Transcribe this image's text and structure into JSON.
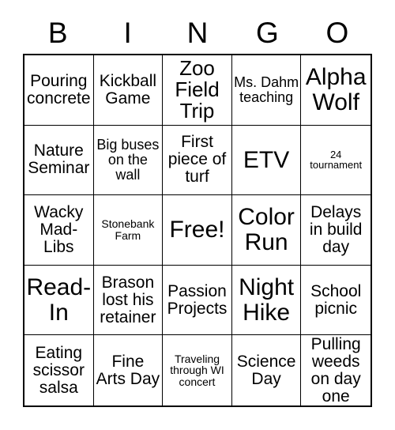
{
  "card": {
    "header_letters": [
      "B",
      "I",
      "N",
      "G",
      "O"
    ],
    "columns": 5,
    "rows": 5,
    "border_color": "#000000",
    "background_color": "#ffffff",
    "text_color": "#000000",
    "cells": [
      {
        "text": "Pouring concrete",
        "size": "md"
      },
      {
        "text": "Kickball Game",
        "size": "md"
      },
      {
        "text": "Zoo Field Trip",
        "size": "lg"
      },
      {
        "text": "Ms. Dahm teaching",
        "size": "sm"
      },
      {
        "text": "Alpha Wolf",
        "size": "xl"
      },
      {
        "text": "Nature Seminar",
        "size": "md"
      },
      {
        "text": "Big buses on the wall",
        "size": "sm"
      },
      {
        "text": "First piece of turf",
        "size": "md"
      },
      {
        "text": "ETV",
        "size": "xl"
      },
      {
        "text": "24 tournament",
        "size": "xxs"
      },
      {
        "text": "Wacky Mad-Libs",
        "size": "md"
      },
      {
        "text": "Stonebank Farm",
        "size": "xs"
      },
      {
        "text": "Free!",
        "size": "xl"
      },
      {
        "text": "Color Run",
        "size": "xl"
      },
      {
        "text": "Delays in build day",
        "size": "md"
      },
      {
        "text": "Read-In",
        "size": "xl"
      },
      {
        "text": "Brason lost his retainer",
        "size": "md"
      },
      {
        "text": "Passion Projects",
        "size": "md"
      },
      {
        "text": "Night Hike",
        "size": "xl"
      },
      {
        "text": "School picnic",
        "size": "md"
      },
      {
        "text": "Eating scissor salsa",
        "size": "md"
      },
      {
        "text": "Fine Arts Day",
        "size": "md"
      },
      {
        "text": "Traveling through WI concert",
        "size": "xs"
      },
      {
        "text": "Science Day",
        "size": "md"
      },
      {
        "text": "Pulling weeds on day one",
        "size": "md"
      }
    ]
  }
}
